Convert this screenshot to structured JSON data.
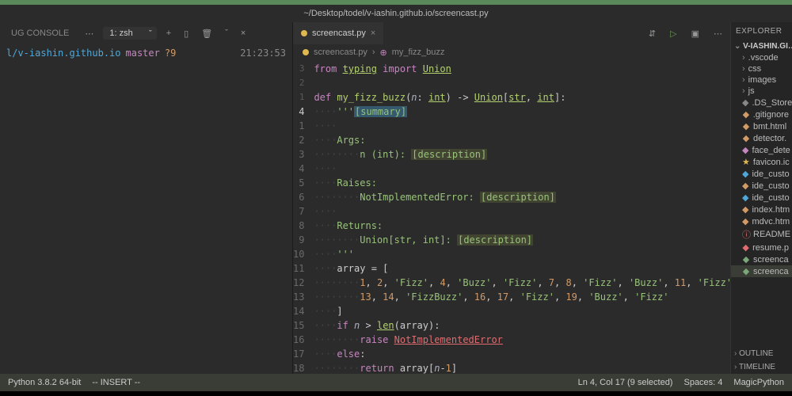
{
  "titlebar": "~/Desktop/todel/v-iashin.github.io/screencast.py",
  "left_panel": {
    "tab": "UG CONSOLE",
    "menu": "⋯",
    "term_selector": "1: zsh",
    "icons": {
      "add": "+",
      "split": "▯",
      "trash": "🗑",
      "chev": "ˇ",
      "close": "×"
    },
    "prompt": {
      "cwd": "l/v-iashin.github.io",
      "branch": "master",
      "dirty": "?9",
      "time": "21:23:53"
    }
  },
  "tab": {
    "name": "screencast.py",
    "close": "×"
  },
  "tabbar_icons": {
    "compare": "⇵",
    "run": "▷",
    "split": "▣",
    "more": "⋯"
  },
  "breadcrumb": {
    "file": "screencast.py",
    "sep": "›",
    "symbol": "my_fizz_buzz"
  },
  "gutter_blame": [
    "3",
    "2",
    "1"
  ],
  "gutter": [
    "4",
    "1",
    "2",
    "3",
    "4",
    "5",
    "6",
    "7",
    "8",
    "9",
    "10",
    "11",
    "12",
    "13",
    "14",
    "15",
    "16",
    "17",
    "18"
  ],
  "code": {
    "l0": {
      "a": "from ",
      "b": "typing",
      "c": " import ",
      "d": "Union"
    },
    "l2": {
      "a": "def ",
      "b": "my_fizz_buzz",
      "c": "(",
      "d": "n",
      "e": ": ",
      "f": "int",
      "g": ") -> ",
      "h": "Union",
      "i": "[",
      "j": "str",
      "k": ", ",
      "l": "int",
      "m": "]:"
    },
    "l3": {
      "pad": "    ",
      "a": "'''",
      "b": "[summary]"
    },
    "l5": {
      "pad": "    ",
      "a": "Args:"
    },
    "l6": {
      "pad": "        ",
      "a": "n (int): ",
      "b": "[description]"
    },
    "l8": {
      "pad": "    ",
      "a": "Raises:"
    },
    "l9": {
      "pad": "        ",
      "a": "NotImplementedError: ",
      "b": "[description]"
    },
    "l11": {
      "pad": "    ",
      "a": "Returns:"
    },
    "l12": {
      "pad": "        ",
      "a": "Union[str, int]: ",
      "b": "[description]"
    },
    "l13": {
      "pad": "    ",
      "a": "'''"
    },
    "l14": {
      "pad": "    ",
      "a": "array = ["
    },
    "l15": {
      "pad": "        ",
      "vals": "1, 2, 'Fizz', 4, 'Buzz', 'Fizz', 7, 8, 'Fizz', 'Buzz', 11, 'Fizz',"
    },
    "l16": {
      "pad": "        ",
      "vals": "13, 14, 'FizzBuzz', 16, 17, 'Fizz', 19, 'Buzz', 'Fizz'"
    },
    "l17": {
      "pad": "    ",
      "a": "]"
    },
    "l18": {
      "pad": "    ",
      "a": "if ",
      "b": "n",
      "c": " > ",
      "d": "len",
      "e": "(array):"
    },
    "l19": {
      "pad": "        ",
      "a": "raise ",
      "b": "NotImplementedError"
    },
    "l20": {
      "pad": "    ",
      "a": "else",
      "b": ":"
    },
    "l21": {
      "pad": "        ",
      "a": "return ",
      "b": "array[",
      "c": "n",
      "d": "-",
      "e": "1",
      "f": "]"
    }
  },
  "code_literals": {
    "l15": [
      "1",
      "2",
      "'Fizz'",
      "4",
      "'Buzz'",
      "'Fizz'",
      "7",
      "8",
      "'Fizz'",
      "'Buzz'",
      "11",
      "'Fizz'"
    ],
    "l16": [
      "13",
      "14",
      "'FizzBuzz'",
      "16",
      "17",
      "'Fizz'",
      "19",
      "'Buzz'",
      "'Fizz'"
    ]
  },
  "explorer": {
    "title": "EXPLORER",
    "root": "V-IASHIN.GI…",
    "folders": [
      ".vscode",
      "css",
      "images",
      "js"
    ],
    "files": [
      {
        "n": ".DS_Store",
        "c": "fi-gr"
      },
      {
        "n": ".gitignore",
        "c": "fi-o"
      },
      {
        "n": "bmt.html",
        "c": "fi-o"
      },
      {
        "n": "detector.",
        "c": "fi-o"
      },
      {
        "n": "face_dete",
        "c": "fi-p"
      },
      {
        "n": "favicon.ic",
        "c": "fi-y"
      },
      {
        "n": "ide_custo",
        "c": "fi-b"
      },
      {
        "n": "ide_custo",
        "c": "fi-o"
      },
      {
        "n": "ide_custo",
        "c": "fi-b"
      },
      {
        "n": "index.htm",
        "c": "fi-o"
      },
      {
        "n": "mdvc.htm",
        "c": "fi-o"
      },
      {
        "n": "README",
        "c": "fi-r"
      },
      {
        "n": "resume.p",
        "c": "fi-r"
      },
      {
        "n": "screenca",
        "c": "fi-g"
      },
      {
        "n": "screenca",
        "c": "fi-g",
        "active": true
      }
    ],
    "sections": [
      "OUTLINE",
      "TIMELINE"
    ]
  },
  "status": {
    "python": "Python 3.8.2 64-bit",
    "mode": "-- INSERT --",
    "pos": "Ln 4, Col 17 (9 selected)",
    "spaces": "Spaces: 4",
    "lang": "MagicPython"
  },
  "glyph": {
    "folder": "›",
    "chev": "›",
    "file": "◆",
    "star": "★",
    "info": "ⓘ"
  }
}
